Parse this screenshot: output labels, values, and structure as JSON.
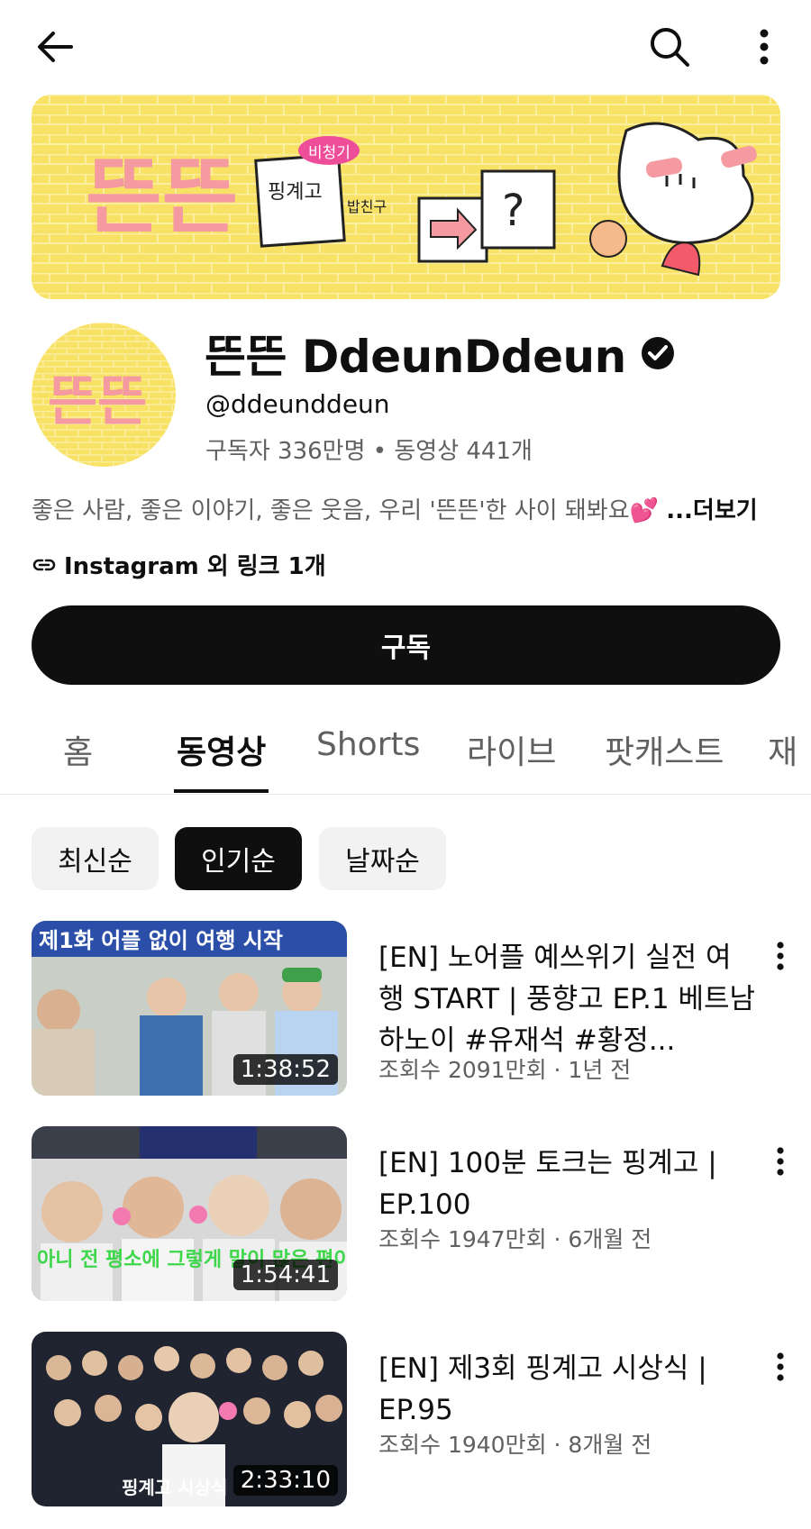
{
  "channel": {
    "name": "뜬뜬 DdeunDdeun",
    "handle": "@ddeunddeun",
    "stats": "구독자 336만명 • 동영상 441개",
    "description": "좋은 사람, 좋은 이야기, 좋은 웃음, 우리 '뜬뜬'한 사이 돼봐요💕 ",
    "description_more": "...더보기",
    "links": "Instagram 외 링크 1개",
    "subscribe_label": "구독",
    "banner_logo_text": "뜬뜬",
    "banner_texts": {
      "bubble": "비청기",
      "card": "핑계고",
      "side": "밥친구",
      "question": "?"
    },
    "avatar_logo_text": "뜬뜬"
  },
  "tabs": [
    {
      "label": "홈",
      "active": false
    },
    {
      "label": "동영상",
      "active": true
    },
    {
      "label": "Shorts",
      "active": false
    },
    {
      "label": "라이브",
      "active": false
    },
    {
      "label": "팟캐스트",
      "active": false
    },
    {
      "label": "재",
      "active": false
    }
  ],
  "chips": [
    {
      "label": "최신순",
      "active": false
    },
    {
      "label": "인기순",
      "active": true
    },
    {
      "label": "날짜순",
      "active": false
    }
  ],
  "videos": [
    {
      "title": "[EN] 노어플 예쓰위기 실전 여행 START | 풍향고 EP.1 베트남 하노이 #유재석 #황정...",
      "meta": "조회수 2091만회 · 1년 전",
      "duration": "1:38:52",
      "thumb_caption": "제1화 어플 없이 여행 시작"
    },
    {
      "title": "[EN] 100분 토크는 핑계고 | EP.100",
      "meta": "조회수 1947만회 · 6개월 전",
      "duration": "1:54:41",
      "thumb_caption": "아니 전 평소에 그렇게 말이 많은 편이 아니니까"
    },
    {
      "title": "[EN] 제3회 핑계고 시상식 | EP.95",
      "meta": "조회수 1940만회 · 8개월 전",
      "duration": "2:33:10",
      "thumb_caption": "핑계고 시상식"
    }
  ],
  "colors": {
    "brand_yellow": "#f7e266",
    "brand_pink": "#f49aa0",
    "text_primary": "#0f0f0f",
    "text_secondary": "#606060",
    "chip_bg": "#f2f2f2"
  }
}
